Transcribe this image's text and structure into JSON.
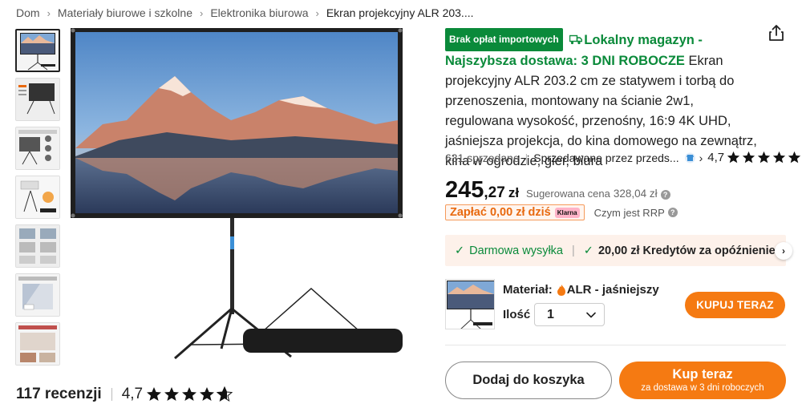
{
  "breadcrumb": {
    "items": [
      "Dom",
      "Materiały biurowe i szkolne",
      "Elektronika biurowa",
      "Ekran projekcyjny ALR 203...."
    ]
  },
  "gallery": {
    "thumbnail_count": 7,
    "active_index": 0
  },
  "reviews": {
    "count_label": "117 recenzji",
    "rating": "4,7",
    "stars": 4.7
  },
  "product": {
    "import_badge": "Brak opłat importowych",
    "local_warehouse": "Lokalny magazyn - Najszybsza dostawa: 3 DNI ROBOCZE",
    "title": " Ekran projekcyjny ALR 203.2 cm ze statywem i torbą do przenoszenia, montowany na ścianie 2w1, regulowana wysokość, przenośny, 16:9 4K UHD, jaśniejsza projekcja, do kina domowego na zewnątrz, kina w ogrodzie, gier, biura"
  },
  "meta": {
    "sold": "631 sprzedane",
    "seller": "Sprzedawane przez przeds...",
    "rating": "4,7",
    "stars": 4.7
  },
  "price": {
    "integer": "245",
    "decimal": ",27",
    "currency": "zł",
    "rrp_label": "Sugerowana cena",
    "rrp_value": "328,04 zł"
  },
  "klarna": {
    "text": "Zapłać 0,00 zł dziś",
    "logo": "Klarna",
    "rrp_link": "Czym jest RRP"
  },
  "benefits": {
    "free_shipping": "Darmowa wysyłka",
    "credit": "20,00 zł Kredytów za opóźnienie"
  },
  "variant": {
    "material_label": "Materiał:",
    "material_value": "ALR - jaśniejszy",
    "quantity_label": "Ilość",
    "quantity_value": "1",
    "buy_now_small": "KUPUJ TERAZ"
  },
  "actions": {
    "add_to_cart": "Dodaj do koszyka",
    "buy_now": "Kup teraz",
    "buy_now_sub": "za dostawa w 3 dni roboczych"
  },
  "colors": {
    "accent_orange": "#f57a12",
    "green": "#0a8a3a",
    "klarna_pink": "#ffb3c7"
  },
  "icons": [
    "truck-icon",
    "share-icon",
    "store-icon",
    "star-icon",
    "check-icon",
    "flame-icon",
    "chevron-down-icon",
    "chevron-right-icon",
    "info-icon"
  ]
}
